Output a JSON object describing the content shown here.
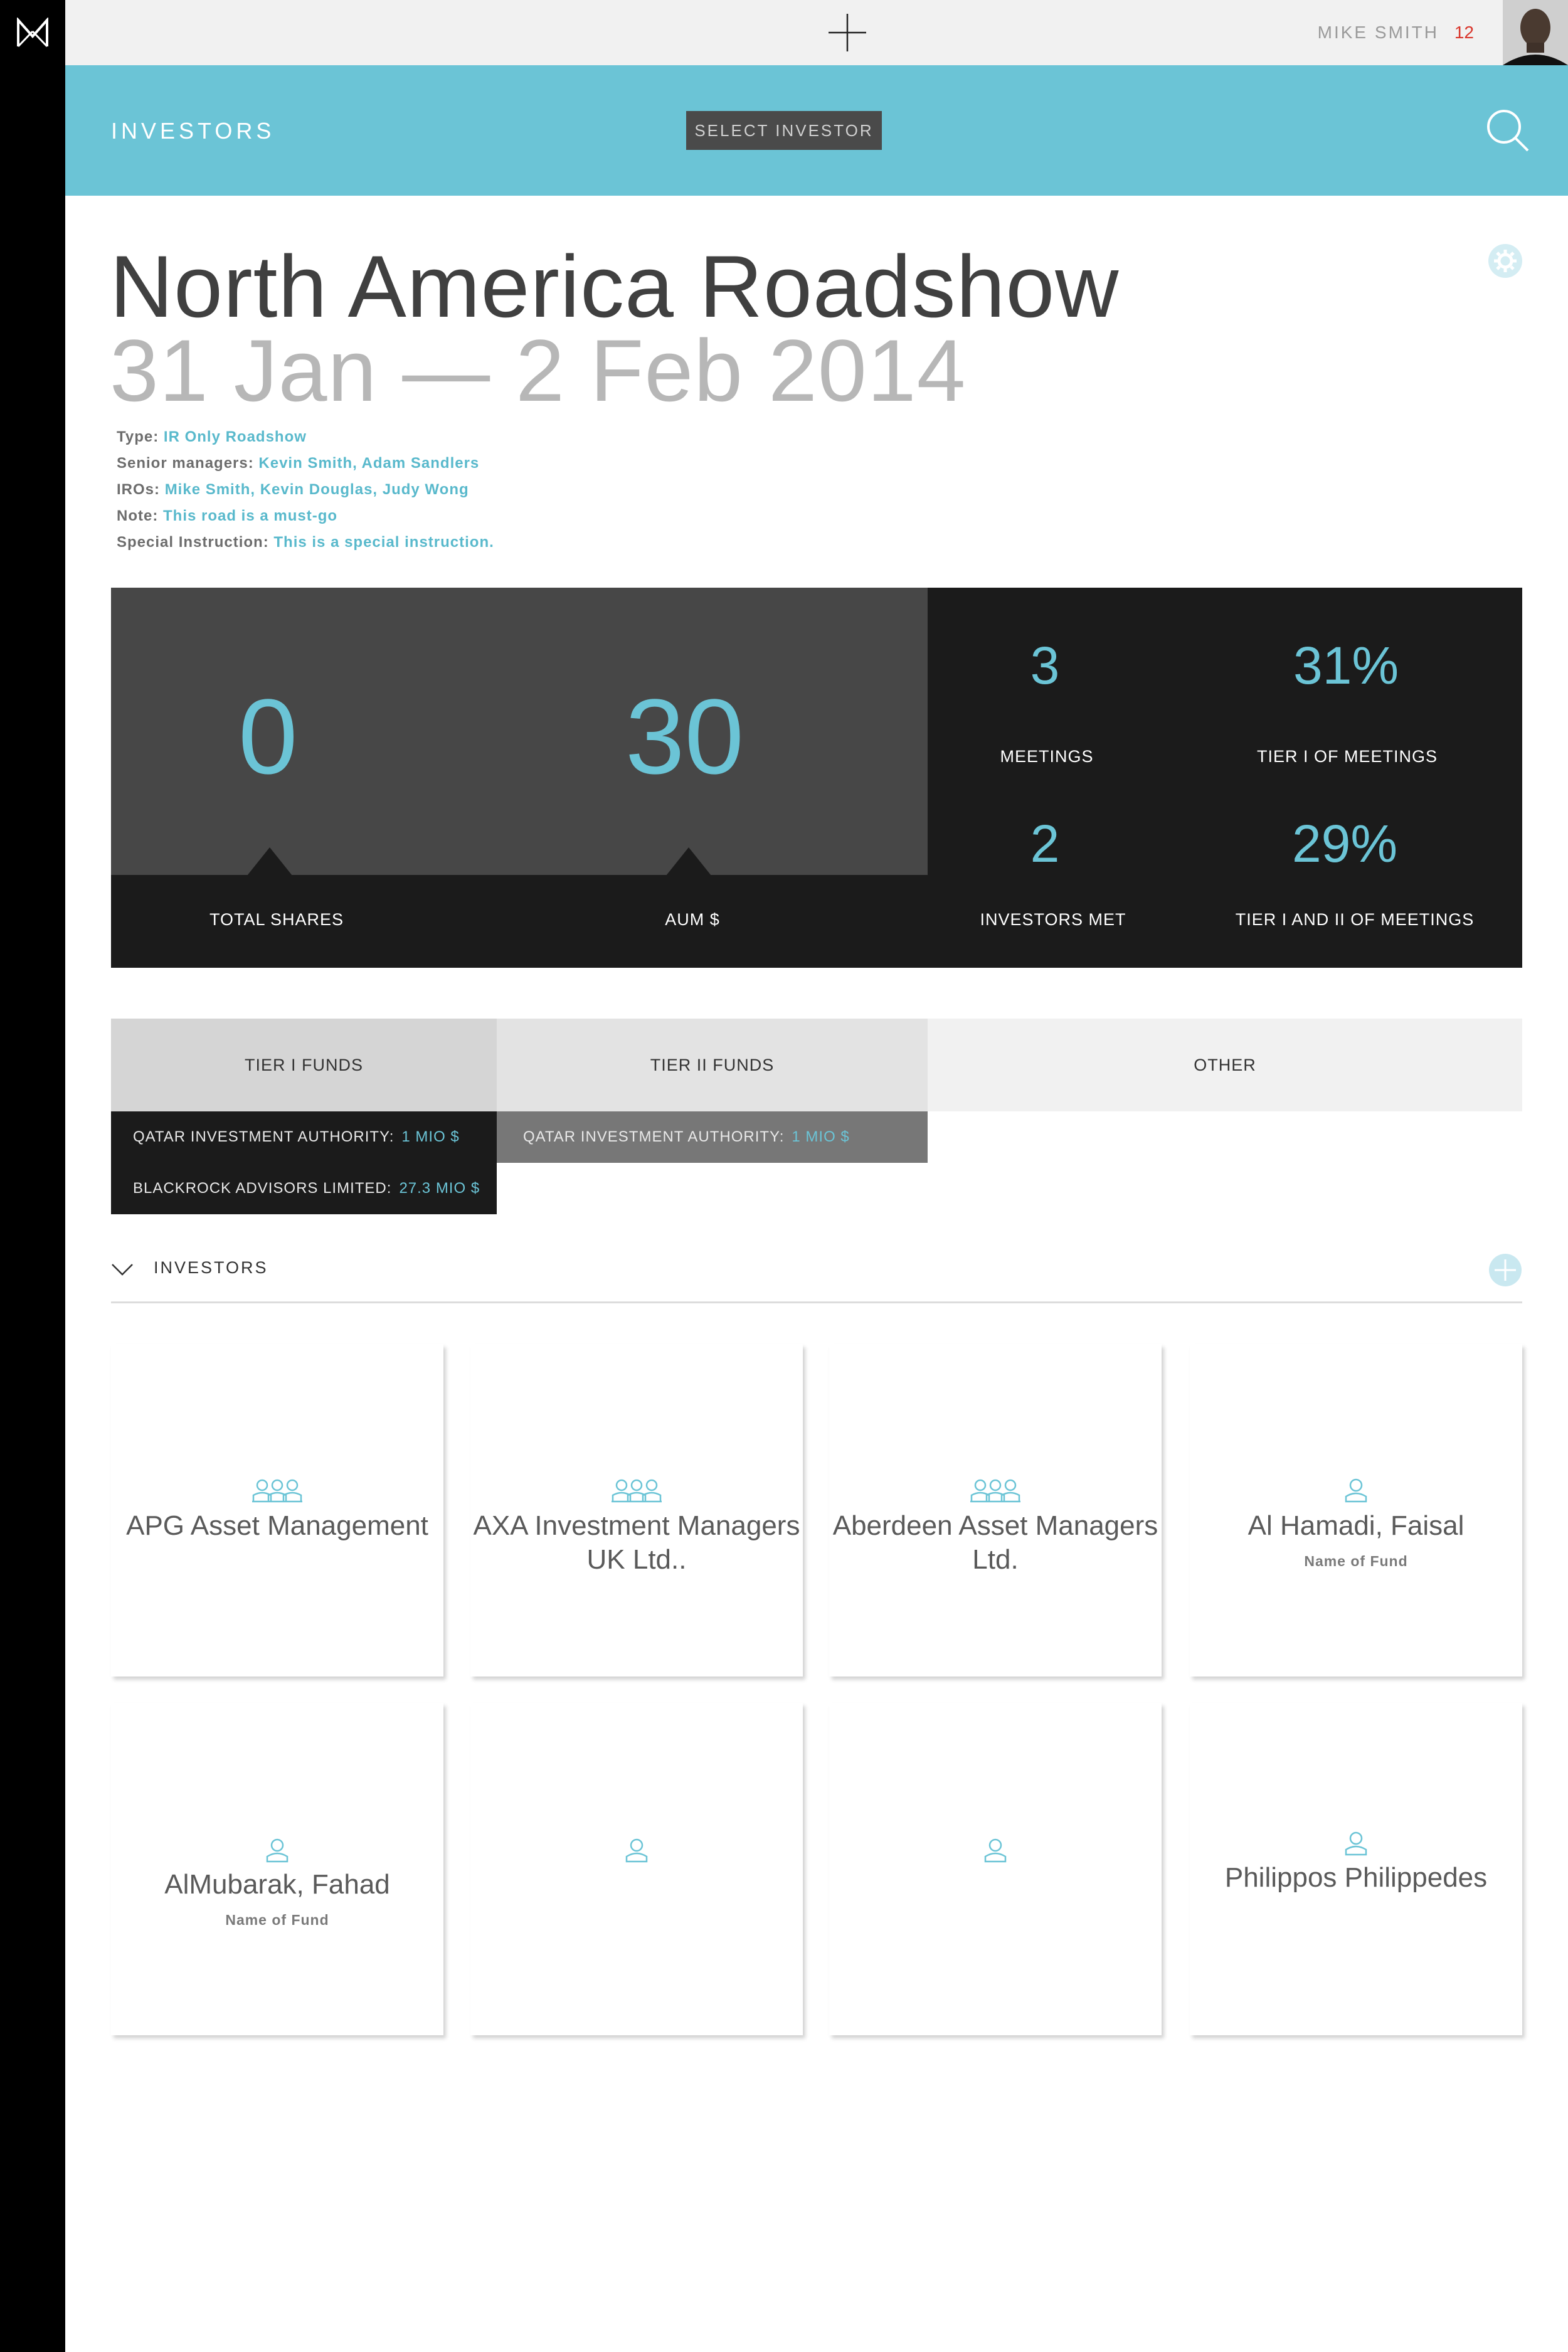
{
  "app": {
    "logo": "M"
  },
  "topbar": {
    "user_name": "MIKE SMITH",
    "notification_count": "12"
  },
  "header": {
    "title": "INVESTORS",
    "select_button": "SELECT INVESTOR"
  },
  "roadshow": {
    "title": "North America Roadshow",
    "dates": "31 Jan — 2 Feb 2014",
    "meta": [
      {
        "label": "Type:",
        "value": "IR Only Roadshow"
      },
      {
        "label": "Senior managers:",
        "value": "Kevin Smith, Adam Sandlers"
      },
      {
        "label": "IROs:",
        "value": "Mike Smith, Kevin Douglas, Judy Wong"
      },
      {
        "label": "Note:",
        "value": "This road is a must-go"
      },
      {
        "label": "Special Instruction:",
        "value": "This is a special instruction."
      }
    ]
  },
  "stats": {
    "total_shares": {
      "value": "0",
      "label": "TOTAL SHARES"
    },
    "aum": {
      "value": "30",
      "label": "AUM $"
    },
    "meetings": {
      "value": "3",
      "label": "MEETINGS"
    },
    "tier1_meetings": {
      "value": "31%",
      "label": "TIER I OF MEETINGS"
    },
    "investors_met": {
      "value": "2",
      "label": "INVESTORS MET"
    },
    "tier12_meetings": {
      "value": "29%",
      "label": "TIER I AND II OF MEETINGS"
    }
  },
  "tiers": {
    "tabs": [
      {
        "label": "TIER I FUNDS"
      },
      {
        "label": "TIER II FUNDS"
      },
      {
        "label": "OTHER"
      }
    ],
    "tier1_funds": [
      {
        "name": "QATAR INVESTMENT AUTHORITY:",
        "amount": "1 MIO $"
      },
      {
        "name": "BLACKROCK ADVISORS LIMITED:",
        "amount": "27.3 MIO $"
      }
    ],
    "tier2_funds": [
      {
        "name": "QATAR INVESTMENT AUTHORITY:",
        "amount": "1 MIO $"
      }
    ]
  },
  "investors": {
    "title": "INVESTORS",
    "cards": [
      {
        "icon": "group-icon",
        "name": "APG Asset Management",
        "subtitle": ""
      },
      {
        "icon": "group-icon",
        "name": "AXA Investment Managers UK Ltd..",
        "subtitle": ""
      },
      {
        "icon": "group-icon",
        "name": "Aberdeen Asset Managers Ltd.",
        "subtitle": ""
      },
      {
        "icon": "person-icon",
        "name": "Al Hamadi, Faisal",
        "subtitle": "Name of Fund"
      },
      {
        "icon": "person-icon",
        "name": "AlMubarak, Fahad",
        "subtitle": "Name of Fund"
      },
      {
        "icon": "person-icon",
        "name": "",
        "subtitle": ""
      },
      {
        "icon": "person-icon",
        "name": "",
        "subtitle": ""
      },
      {
        "icon": "person-icon",
        "name": "Philippos Philippedes",
        "subtitle": ""
      }
    ]
  },
  "colors": {
    "accent": "#6bc4d6",
    "dark": "#1b1b1b",
    "mid": "#474747",
    "alert": "#d9352b"
  }
}
